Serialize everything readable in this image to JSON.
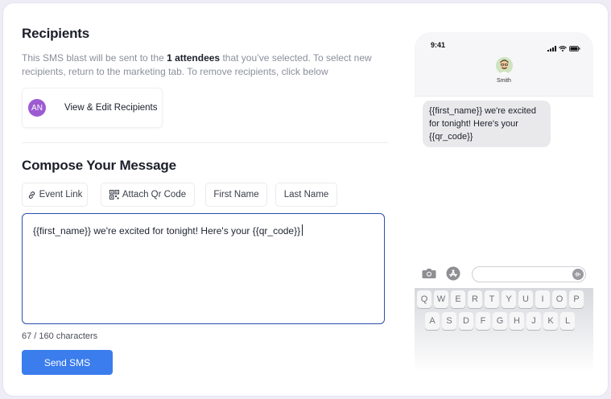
{
  "recipients": {
    "title": "Recipients",
    "desc_pre": "This SMS blast will be sent to the ",
    "desc_bold": "1 attendees",
    "desc_post": " that you’ve selected. To select new recipients, return to the marketing tab. To remove recipients, click below",
    "avatar_initials": "AN",
    "edit_label": "View & Edit Recipients",
    "avatar_color": "#9d5bd2"
  },
  "compose": {
    "title": "Compose Your Message",
    "chips": {
      "event_link": "Event Link",
      "attach_qr": "Attach Qr Code",
      "first_name": "First Name",
      "last_name": "Last Name"
    },
    "message": "{{first_name}} we're excited for tonight! Here's your {{qr_code}}",
    "counter": "67 / 160 characters",
    "send_label": "Send SMS",
    "send_color": "#3b7ded"
  },
  "phone": {
    "time": "9:41",
    "contact_name": "Smith",
    "bubble_text": "{{first_name}} we're excited for tonight! Here's your {{qr_code}}",
    "keyboard_row1": [
      "Q",
      "W",
      "E",
      "R",
      "T",
      "Y",
      "U",
      "I",
      "O",
      "P"
    ],
    "keyboard_row2": [
      "A",
      "S",
      "D",
      "F",
      "G",
      "H",
      "J",
      "K",
      "L"
    ]
  }
}
